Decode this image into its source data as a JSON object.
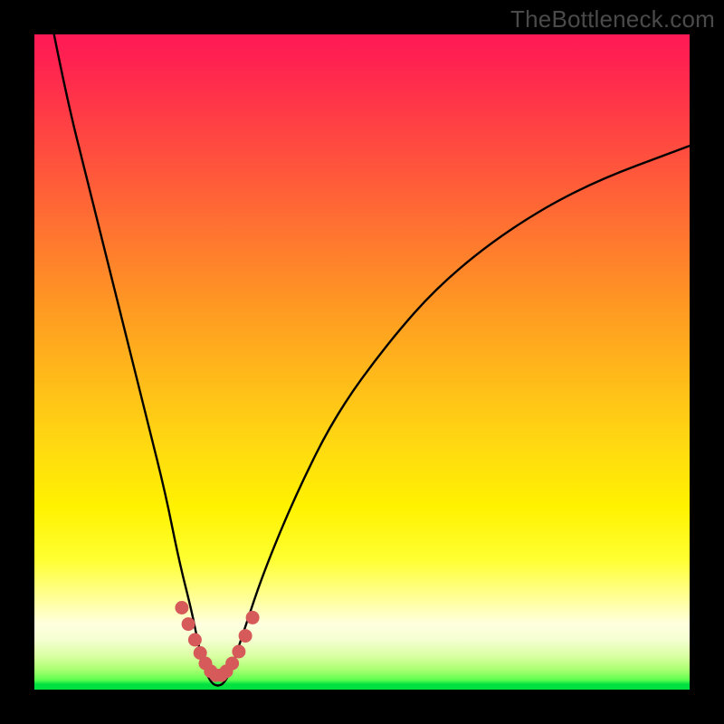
{
  "watermark": "TheBottleneck.com",
  "colors": {
    "page_bg": "#000000",
    "curve": "#000000",
    "marker": "#d65a5a",
    "watermark_text": "#4a4a4a"
  },
  "chart_data": {
    "type": "line",
    "title": "",
    "xlabel": "",
    "ylabel": "",
    "xlim": [
      0,
      100
    ],
    "ylim": [
      0,
      100
    ],
    "grid": false,
    "legend": false,
    "note": "Axes are unlabeled in the source image; units unknown. Values are read off by pixel position as percentage of plot area. y-axis is inverted visually (0 at bottom).",
    "series": [
      {
        "name": "curve",
        "x": [
          3,
          5,
          8,
          11,
          14,
          17,
          20,
          22,
          24,
          25,
          26,
          27,
          28,
          29,
          30,
          32,
          35,
          40,
          46,
          54,
          62,
          72,
          84,
          100
        ],
        "y": [
          100,
          90,
          78,
          66,
          54,
          42,
          30,
          20,
          12,
          7,
          3,
          1,
          0.5,
          1,
          3,
          9,
          18,
          30,
          42,
          53,
          62,
          70,
          77,
          83
        ]
      },
      {
        "name": "highlight",
        "x": [
          22.5,
          23.5,
          24.5,
          25.3,
          26.1,
          26.9,
          27.7,
          28.5,
          29.3,
          30.2,
          31.2,
          32.2,
          33.3
        ],
        "y": [
          12.5,
          10.0,
          7.6,
          5.6,
          4.0,
          2.8,
          2.2,
          2.2,
          2.8,
          4.0,
          5.8,
          8.2,
          11.0
        ]
      }
    ],
    "minimum": {
      "x": 28,
      "y": 0.5
    }
  }
}
